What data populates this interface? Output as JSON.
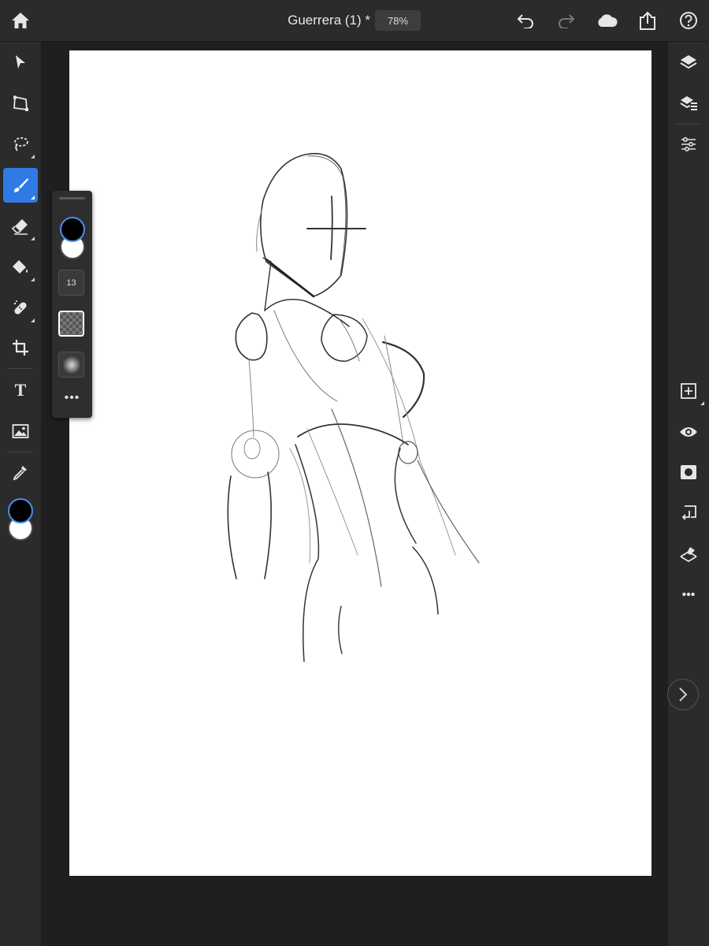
{
  "app": {
    "document_title": "Guerrera (1) *",
    "zoom": "78%"
  },
  "topbar": {
    "icons": [
      "home-icon",
      "undo-icon",
      "redo-icon",
      "cloud-icon",
      "share-icon",
      "help-icon"
    ]
  },
  "left_toolbar": {
    "tools": [
      "select",
      "transform",
      "lasso",
      "brush",
      "eraser",
      "fill",
      "heal",
      "crop",
      "type",
      "image",
      "eyedropper"
    ],
    "active_tool": "brush",
    "text_tool_glyph": "T",
    "foreground_color": "#000000",
    "background_color": "#ffffff"
  },
  "brush_panel": {
    "size": "13",
    "more": "•••"
  },
  "right_toolbar": {
    "icons": [
      "layers-icon",
      "layer-properties-icon",
      "adjustments-icon",
      "add-layer-icon",
      "visibility-icon",
      "mask-icon",
      "merge-down-icon",
      "clear-layer-icon",
      "more-icon"
    ],
    "more": "•••"
  },
  "colors": {
    "accent": "#2f7ae5",
    "panel": "#2b2b2b",
    "background": "#1f1f1f",
    "canvas": "#ffffff"
  }
}
